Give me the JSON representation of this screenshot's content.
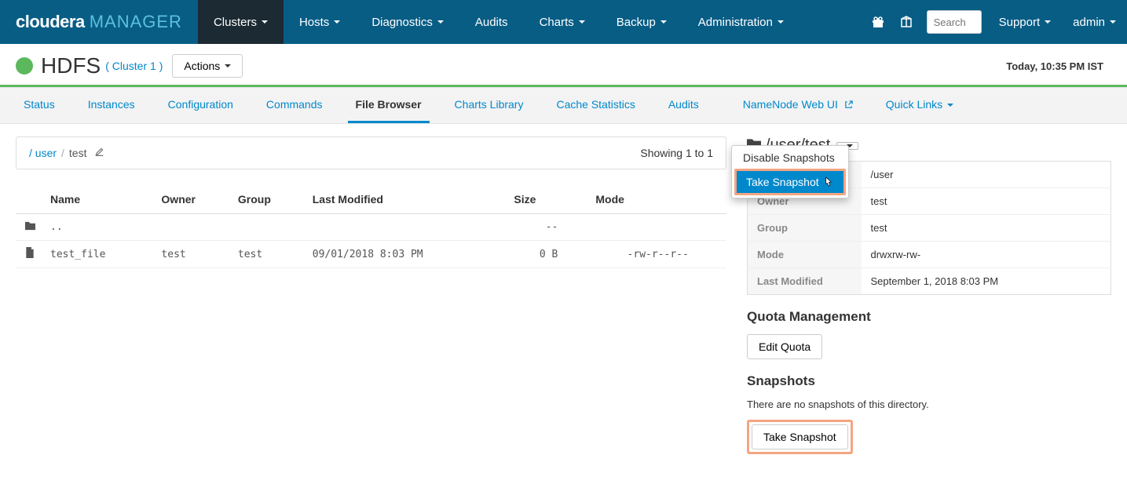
{
  "brand": {
    "name": "cloudera",
    "sub": "MANAGER"
  },
  "nav": {
    "clusters": "Clusters",
    "hosts": "Hosts",
    "diagnostics": "Diagnostics",
    "audits": "Audits",
    "charts": "Charts",
    "backup": "Backup",
    "administration": "Administration",
    "search_placeholder": "Search",
    "support": "Support",
    "admin": "admin"
  },
  "header": {
    "service": "HDFS",
    "cluster": "( Cluster 1 )",
    "actions": "Actions",
    "timestamp": "Today, 10:35 PM IST"
  },
  "tabs": {
    "status": "Status",
    "instances": "Instances",
    "configuration": "Configuration",
    "commands": "Commands",
    "file_browser": "File Browser",
    "charts_library": "Charts Library",
    "cache_statistics": "Cache Statistics",
    "audits": "Audits",
    "namenode": "NameNode Web UI",
    "quick_links": "Quick Links"
  },
  "breadcrumb": {
    "root": "/",
    "user": "user",
    "current": "test",
    "showing": "Showing 1 to 1"
  },
  "table": {
    "headers": {
      "name": "Name",
      "owner": "Owner",
      "group": "Group",
      "last_modified": "Last Modified",
      "size": "Size",
      "mode": "Mode"
    },
    "rows": [
      {
        "name": "..",
        "owner": "",
        "group": "",
        "last_modified": "",
        "size": "--",
        "mode": "",
        "is_dir": true
      },
      {
        "name": "test_file",
        "owner": "test",
        "group": "test",
        "last_modified": "09/01/2018 8:03 PM",
        "size": "0 B",
        "mode": "-rw-r--r--",
        "is_dir": false
      }
    ]
  },
  "details": {
    "title": "/user/test",
    "rows": {
      "parent_k": "",
      "parent_v": "/user",
      "owner_k": "Owner",
      "owner_v": "test",
      "group_k": "Group",
      "group_v": "test",
      "mode_k": "Mode",
      "mode_v": "drwxrw-rw-",
      "lm_k": "Last Modified",
      "lm_v": "September 1, 2018 8:03 PM"
    },
    "quota_h": "Quota Management",
    "edit_quota": "Edit Quota",
    "snapshots_h": "Snapshots",
    "no_snapshots": "There are no snapshots of this directory.",
    "take_snapshot": "Take Snapshot"
  },
  "dropdown": {
    "disable": "Disable Snapshots",
    "take": "Take Snapshot"
  }
}
